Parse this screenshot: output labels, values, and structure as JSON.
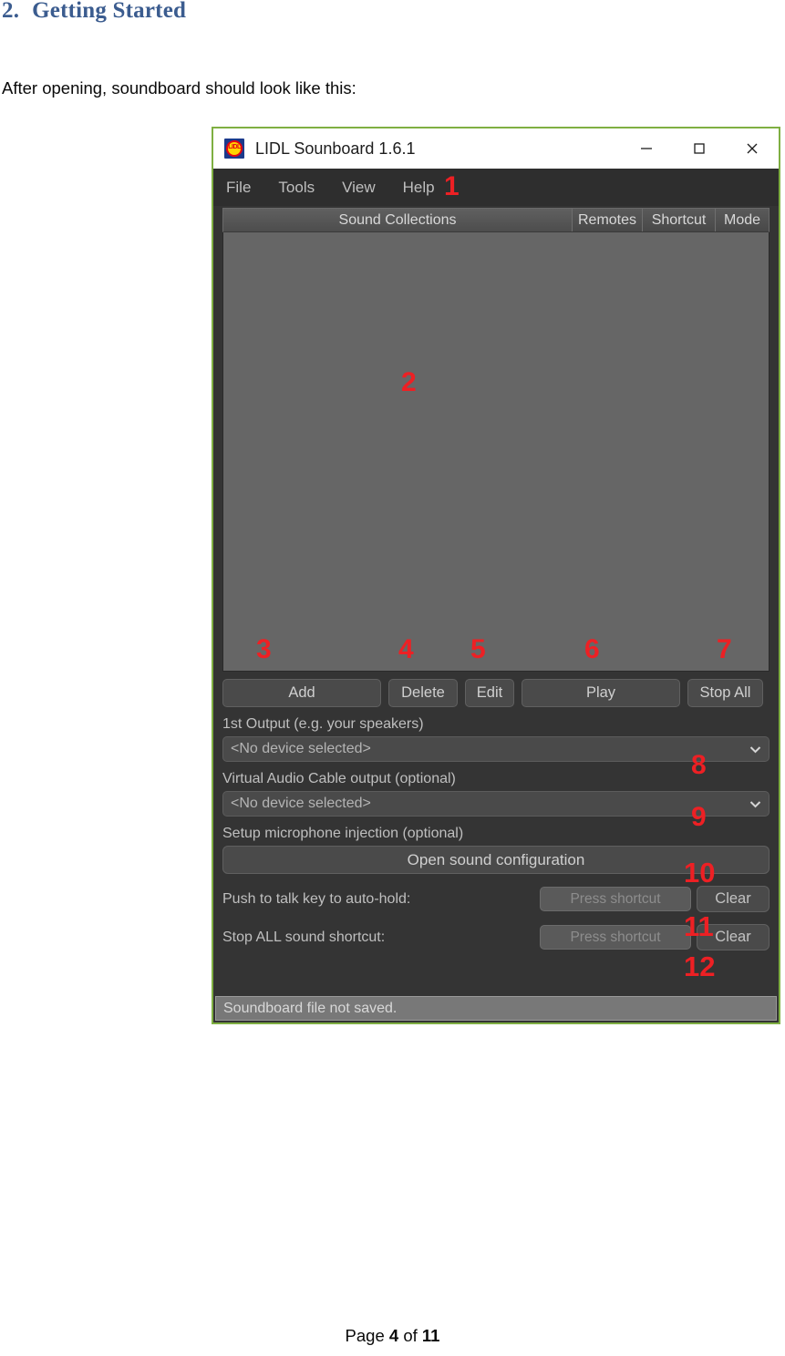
{
  "document": {
    "heading_number": "2.",
    "heading_text": "Getting Started",
    "paragraph": "After opening, soundboard should look like this:",
    "footer_prefix": "Page",
    "footer_page": "4",
    "footer_middle": "of",
    "footer_total": "11"
  },
  "colors": {
    "heading": "#3B5C8F",
    "marker_red": "#ED2024",
    "window_border_green": "#7FAF42",
    "panel_dark": "#343434",
    "list_background": "#666666"
  },
  "app": {
    "title": "LIDL Sounboard 1.6.1",
    "icon_name": "lidl-logo-icon",
    "icon_text": "LIDL",
    "window_buttons": [
      {
        "name": "minimize-button",
        "glyph": "minimize"
      },
      {
        "name": "maximize-button",
        "glyph": "maximize"
      },
      {
        "name": "close-button",
        "glyph": "close"
      }
    ],
    "menu": [
      {
        "label": "File"
      },
      {
        "label": "Tools"
      },
      {
        "label": "View"
      },
      {
        "label": "Help"
      }
    ],
    "list": {
      "columns": [
        {
          "label": "Sound Collections"
        },
        {
          "label": "Remotes"
        },
        {
          "label": "Shortcut"
        },
        {
          "label": "Mode"
        }
      ],
      "rows": []
    },
    "buttons": {
      "add": "Add",
      "delete": "Delete",
      "edit": "Edit",
      "play": "Play",
      "stop_all": "Stop All"
    },
    "output1": {
      "label": "1st Output (e.g. your speakers)",
      "value": "<No device selected>",
      "arrow": "❯"
    },
    "output2": {
      "label": "Virtual Audio Cable output (optional)",
      "value": "<No device selected>",
      "arrow": "❯"
    },
    "mic": {
      "label": "Setup microphone injection (optional)",
      "button": "Open sound configuration"
    },
    "ptt": {
      "label": "Push to talk key to auto-hold:",
      "placeholder": "Press shortcut",
      "clear": "Clear"
    },
    "stop_shortcut": {
      "label": "Stop ALL sound shortcut:",
      "placeholder": "Press shortcut",
      "clear": "Clear"
    },
    "status": "Soundboard file not saved."
  },
  "markers": {
    "m1": "1",
    "m2": "2",
    "m3": "3",
    "m4": "4",
    "m5": "5",
    "m6": "6",
    "m7": "7",
    "m8": "8",
    "m9": "9",
    "m10": "10",
    "m11": "11",
    "m12": "12"
  }
}
